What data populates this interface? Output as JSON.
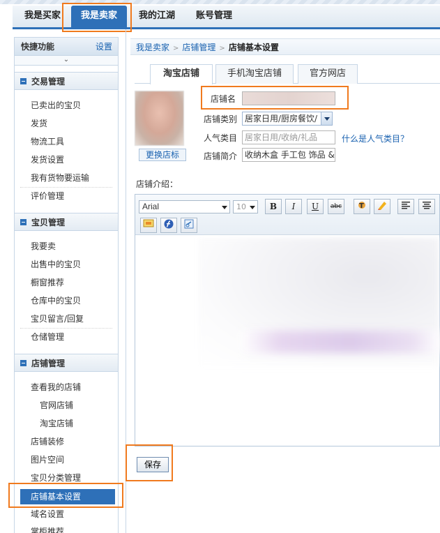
{
  "top_nav": {
    "tabs": [
      {
        "label": "我是买家"
      },
      {
        "label": "我是卖家",
        "active": true
      },
      {
        "label": "我的江湖"
      },
      {
        "label": "账号管理"
      }
    ]
  },
  "sidebar": {
    "quick": {
      "title": "快捷功能",
      "settings_link": "设置"
    },
    "sections": [
      {
        "title": "交易管理",
        "items": [
          "已卖出的宝贝",
          "发货",
          "物流工具",
          "发货设置",
          "我有货物要运输",
          "评价管理"
        ]
      },
      {
        "title": "宝贝管理",
        "items": [
          "我要卖",
          "出售中的宝贝",
          "橱窗推荐",
          "仓库中的宝贝",
          "宝贝留言/回复",
          "仓储管理"
        ]
      },
      {
        "title": "店铺管理",
        "items": [
          "查看我的店铺",
          "官网店铺",
          "淘宝店铺",
          "店铺装修",
          "图片空间",
          "宝贝分类管理",
          "店铺基本设置",
          "域名设置",
          "掌柜推荐"
        ]
      }
    ]
  },
  "breadcrumb": {
    "items": [
      "我是卖家",
      "店铺管理"
    ],
    "current": "店铺基本设置"
  },
  "shop_tabs": [
    {
      "label": "淘宝店铺",
      "active": true
    },
    {
      "label": "手机淘宝店铺"
    },
    {
      "label": "官方网店"
    }
  ],
  "form": {
    "change_logo_button": "更换店标",
    "shop_name": {
      "label": "店铺名",
      "value": ""
    },
    "shop_category": {
      "label": "店铺类别",
      "value": "居家日用/厨房餐饮/"
    },
    "popular_category": {
      "label": "人气类目",
      "placeholder": "居家日用/收纳/礼品"
    },
    "help_link": "什么是人气类目？",
    "shop_intro_short": {
      "label": "店铺简介",
      "value": "收纳木盒 手工包 饰品 &"
    },
    "intro_label": "店铺介绍："
  },
  "editor": {
    "font": "Arial",
    "size": "10",
    "buttons": {
      "bold": "B",
      "italic": "I",
      "underline": "U",
      "strike": "abc"
    }
  },
  "save_button": "保存",
  "colors": {
    "accent": "#2e70b8",
    "highlight": "#f07a1e",
    "link": "#1a62b0"
  }
}
